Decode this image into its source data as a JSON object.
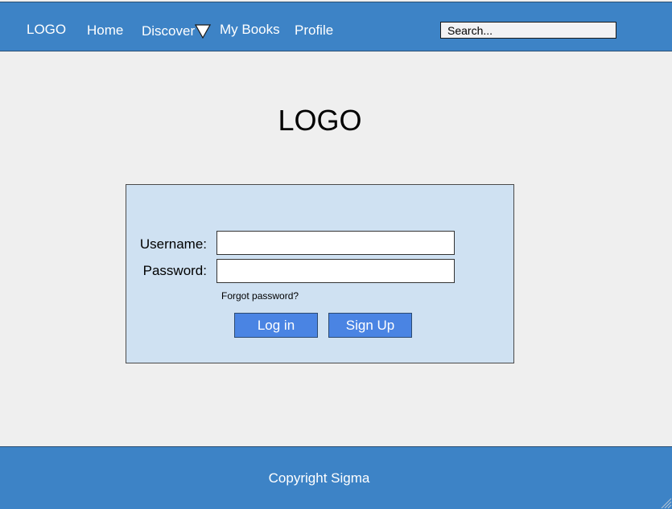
{
  "navbar": {
    "logo": "LOGO",
    "items": [
      {
        "label": "Home"
      },
      {
        "label": "Discover",
        "has_dropdown": true
      },
      {
        "label": "My Books"
      },
      {
        "label": "Profile"
      }
    ],
    "dropdown_icon": "triangle-down-icon",
    "search": {
      "placeholder": "Search...",
      "value": ""
    }
  },
  "main": {
    "logo": "LOGO",
    "login": {
      "username_label": "Username:",
      "username_value": "",
      "password_label": "Password:",
      "password_value": "",
      "forgot_password": "Forgot password?",
      "login_button": "Log in",
      "signup_button": "Sign Up"
    }
  },
  "footer": {
    "copyright": "Copyright Sigma"
  },
  "colors": {
    "header_footer_bg": "#3d83c6",
    "page_bg": "#efefef",
    "panel_bg": "#cfe1f2",
    "button_bg": "#4a84e3"
  }
}
